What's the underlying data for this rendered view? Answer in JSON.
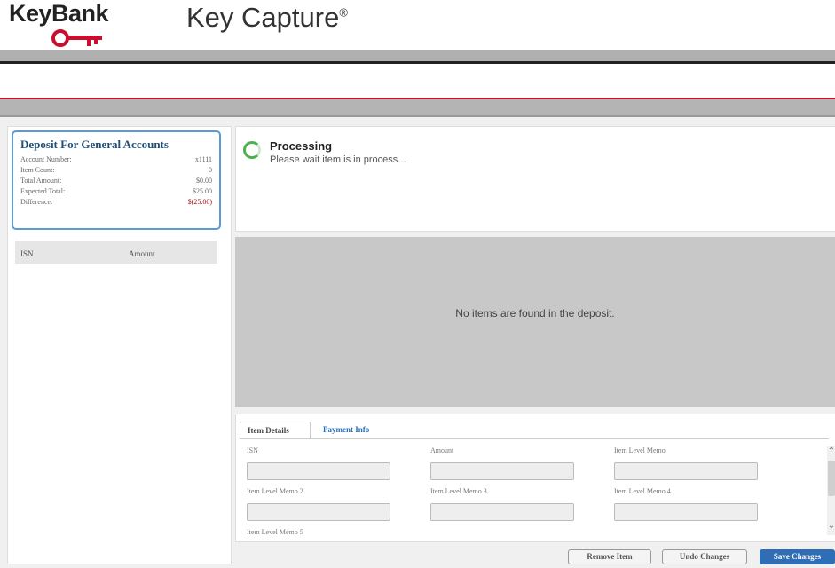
{
  "header": {
    "brand": "KeyBank",
    "app_title": "Key Capture",
    "app_title_mark": "®"
  },
  "deposit": {
    "title": "Deposit For General Accounts",
    "rows": [
      {
        "label": "Account Number:",
        "value": "x1111"
      },
      {
        "label": "Item Count:",
        "value": "0"
      },
      {
        "label": "Total Amount:",
        "value": "$0.00"
      },
      {
        "label": "Expected Total:",
        "value": "$25.00"
      },
      {
        "label": "Difference:",
        "value": "$(25.00)"
      }
    ]
  },
  "item_grid": {
    "columns": [
      "ISN",
      "Amount"
    ]
  },
  "status": {
    "title": "Processing",
    "message": "Please wait item is in process..."
  },
  "empty_message": "No items are found in the deposit.",
  "details": {
    "tabs": [
      "Item Details",
      "Payment Info"
    ],
    "active_tab": "Item Details",
    "fields": [
      "ISN",
      "Amount",
      "Item Level Memo",
      "Item Level Memo 2",
      "Item Level Memo 3",
      "Item Level Memo 4",
      "Item Level Memo 5"
    ]
  },
  "actions": {
    "remove": "Remove Item",
    "undo": "Undo Changes",
    "save": "Save Changes"
  },
  "colors": {
    "accent_blue": "#2f6db5",
    "brand_red": "#c8102e",
    "difference_red": "#a01010",
    "spinner_green": "#4caf50"
  }
}
